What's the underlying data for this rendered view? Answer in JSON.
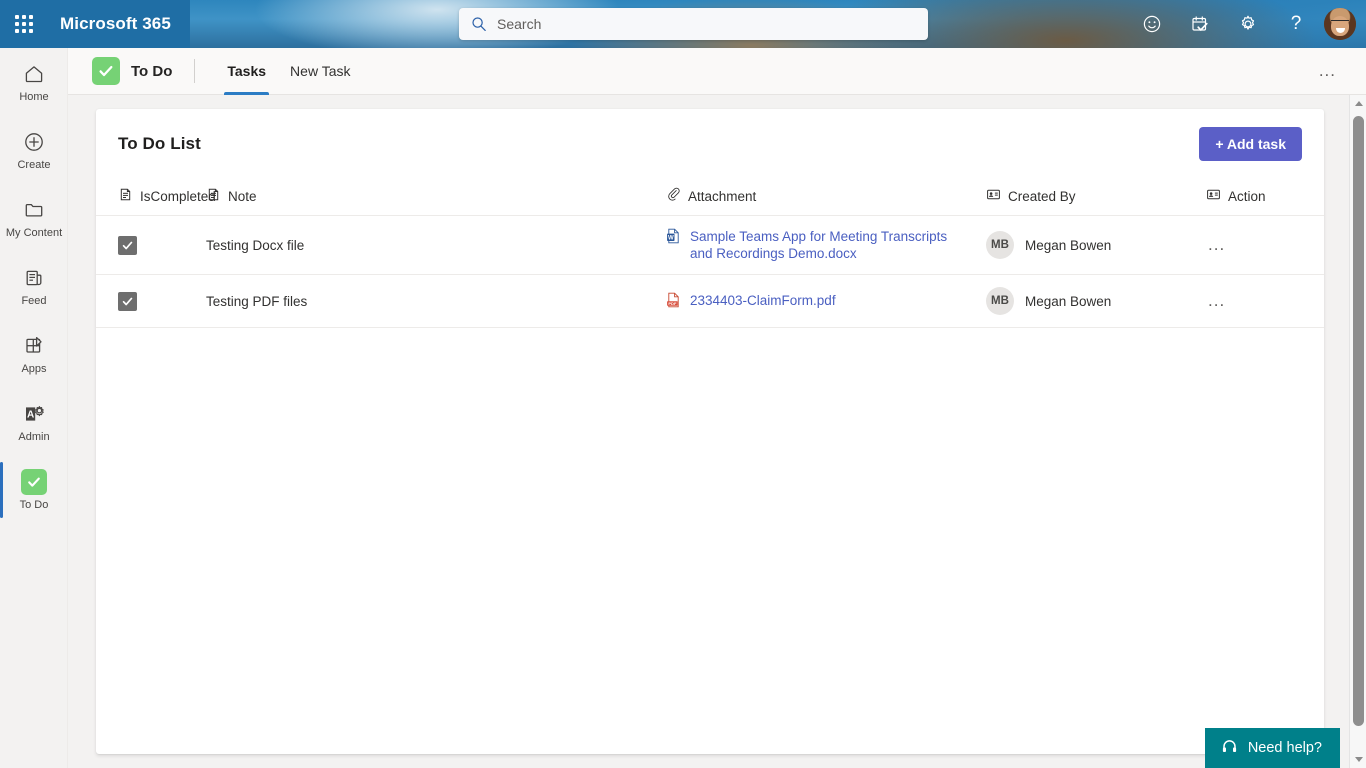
{
  "suite": {
    "waffle_label": "app-launcher",
    "brand": "Microsoft 365",
    "search": {
      "placeholder": "Search",
      "value": ""
    },
    "actions": [
      {
        "name": "feedback-icon",
        "title": "Feedback"
      },
      {
        "name": "tasks-icon",
        "title": "Tasks"
      },
      {
        "name": "settings-icon",
        "title": "Settings"
      },
      {
        "name": "help-icon",
        "title": "Help",
        "glyph": "?"
      }
    ],
    "avatar_alt": "Account manager for Megan Bowen"
  },
  "rail": {
    "items": [
      {
        "label": "Home",
        "icon": "home-icon",
        "active": false
      },
      {
        "label": "Create",
        "icon": "plus-circle-icon",
        "active": false
      },
      {
        "label": "My Content",
        "icon": "folder-icon",
        "active": false
      },
      {
        "label": "Feed",
        "icon": "feed-icon",
        "active": false
      },
      {
        "label": "Apps",
        "icon": "apps-icon",
        "active": false
      },
      {
        "label": "Admin",
        "icon": "admin-icon",
        "active": false
      },
      {
        "label": "To Do",
        "icon": "todo-check-icon",
        "active": true
      }
    ]
  },
  "appbar": {
    "app_name": "To Do",
    "tabs": [
      {
        "label": "Tasks",
        "selected": true
      },
      {
        "label": "New Task",
        "selected": false
      }
    ],
    "overflow_label": "..."
  },
  "card": {
    "title": "To Do List",
    "add_button": "+ Add task",
    "columns": [
      {
        "key": "iscompleted",
        "label": "IsCompleted",
        "icon": "note-icon"
      },
      {
        "key": "note",
        "label": "Note",
        "icon": "note-icon"
      },
      {
        "key": "attachment",
        "label": "Attachment",
        "icon": "paperclip-icon"
      },
      {
        "key": "createdby",
        "label": "Created By",
        "icon": "person-card-icon"
      },
      {
        "key": "action",
        "label": "Action",
        "icon": "person-card-icon"
      }
    ],
    "rows": [
      {
        "completed": true,
        "note": "Testing Docx file",
        "attachment": {
          "name": "Sample Teams App for Meeting Transcripts and Recordings Demo.docx",
          "filetype": "docx"
        },
        "created_by": {
          "initials": "MB",
          "name": "Megan Bowen"
        },
        "action": "..."
      },
      {
        "completed": true,
        "note": "Testing PDF files",
        "attachment": {
          "name": "2334403-ClaimForm.pdf",
          "filetype": "pdf"
        },
        "created_by": {
          "initials": "MB",
          "name": "Megan Bowen"
        },
        "action": "..."
      }
    ]
  },
  "need_help": {
    "label": "Need help?",
    "icon": "headset-icon"
  },
  "colors": {
    "accent_button": "#5b5fc7",
    "todo_green": "#76d275",
    "tab_underline": "#2b7cc4",
    "rail_active": "#2b6fbd",
    "need_help_bg": "#00808a",
    "link": "#4a5fc1"
  }
}
